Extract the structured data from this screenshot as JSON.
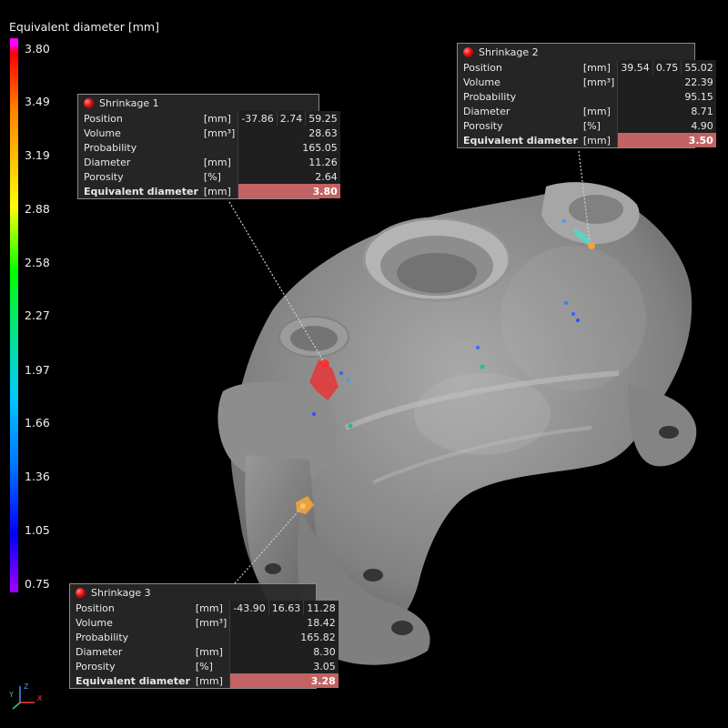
{
  "scale": {
    "title": "Equivalent diameter [mm]",
    "ticks": [
      "3.80",
      "3.49",
      "3.19",
      "2.88",
      "2.58",
      "2.27",
      "1.97",
      "1.66",
      "1.36",
      "1.05",
      "0.75"
    ],
    "max_color": "#ff00ff",
    "min_color": "#9900ff"
  },
  "axes": {
    "z": "Z",
    "y": "Y",
    "x": "X"
  },
  "callouts": [
    {
      "title": "Shrinkage 1",
      "rows": [
        {
          "label": "Position",
          "unit": "[mm]",
          "values": [
            "-37.86",
            "2.74",
            "59.25"
          ]
        },
        {
          "label": "Volume",
          "unit": "[mm³]",
          "values": [
            "28.63"
          ]
        },
        {
          "label": "Probability",
          "unit": "",
          "values": [
            "165.05"
          ]
        },
        {
          "label": "Diameter",
          "unit": "[mm]",
          "values": [
            "11.26"
          ]
        },
        {
          "label": "Porosity",
          "unit": "[%]",
          "values": [
            "2.64"
          ]
        },
        {
          "label": "Equivalent diameter",
          "unit": "[mm]",
          "values": [
            "3.80"
          ],
          "highlight": true
        }
      ]
    },
    {
      "title": "Shrinkage 2",
      "rows": [
        {
          "label": "Position",
          "unit": "[mm]",
          "values": [
            "39.54",
            "0.75",
            "55.02"
          ]
        },
        {
          "label": "Volume",
          "unit": "[mm³]",
          "values": [
            "22.39"
          ]
        },
        {
          "label": "Probability",
          "unit": "",
          "values": [
            "95.15"
          ]
        },
        {
          "label": "Diameter",
          "unit": "[mm]",
          "values": [
            "8.71"
          ]
        },
        {
          "label": "Porosity",
          "unit": "[%]",
          "values": [
            "4.90"
          ]
        },
        {
          "label": "Equivalent diameter",
          "unit": "[mm]",
          "values": [
            "3.50"
          ],
          "highlight": true
        }
      ]
    },
    {
      "title": "Shrinkage 3",
      "rows": [
        {
          "label": "Position",
          "unit": "[mm]",
          "values": [
            "-43.90",
            "16.63",
            "11.28"
          ]
        },
        {
          "label": "Volume",
          "unit": "[mm³]",
          "values": [
            "18.42"
          ]
        },
        {
          "label": "Probability",
          "unit": "",
          "values": [
            "165.82"
          ]
        },
        {
          "label": "Diameter",
          "unit": "[mm]",
          "values": [
            "8.30"
          ]
        },
        {
          "label": "Porosity",
          "unit": "[%]",
          "values": [
            "3.05"
          ]
        },
        {
          "label": "Equivalent diameter",
          "unit": "[mm]",
          "values": [
            "3.28"
          ],
          "highlight": true
        }
      ]
    }
  ]
}
